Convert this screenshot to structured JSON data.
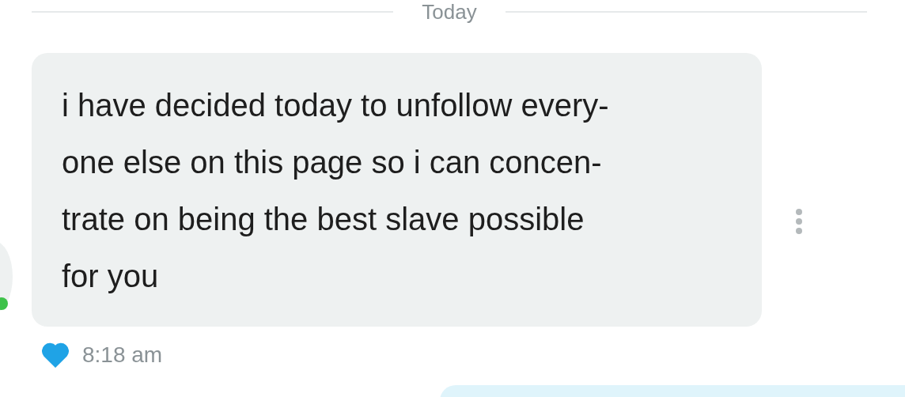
{
  "date_divider": {
    "label": "Today"
  },
  "contact": {
    "online": true
  },
  "message": {
    "lines": [
      "i have decided today to unfollow every-",
      "one else on this page so i can concen-",
      "trate on being the best slave possible",
      "for you"
    ],
    "liked": true,
    "time": "8:18 am"
  }
}
